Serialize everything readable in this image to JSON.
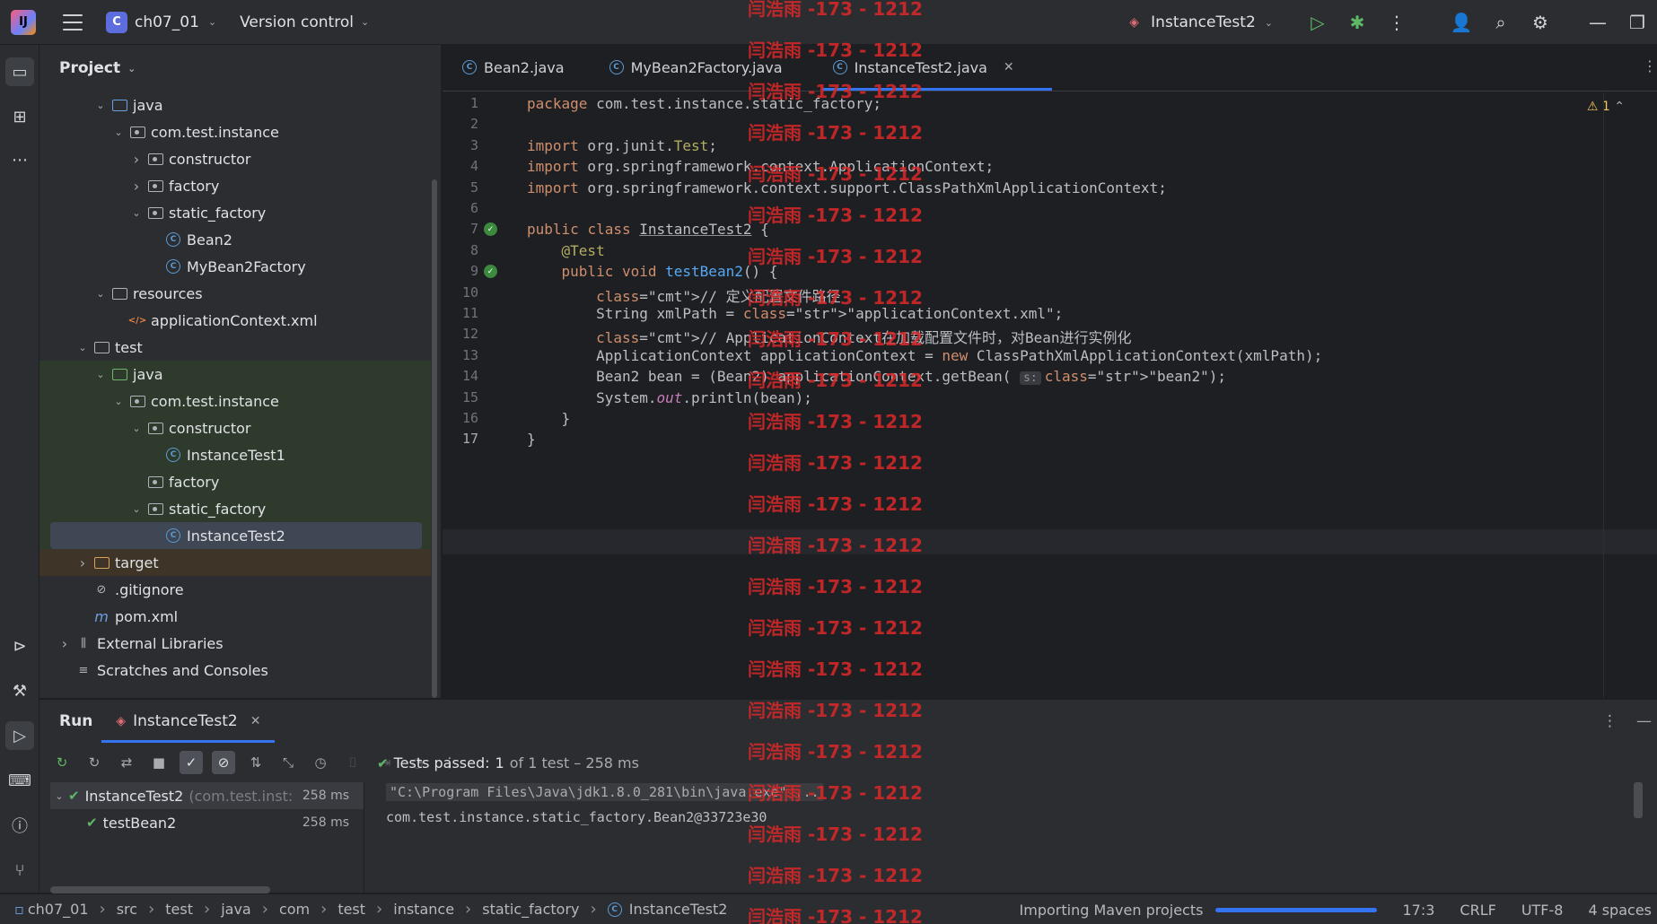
{
  "titlebar": {
    "logo": "IJ",
    "project_badge": "C",
    "project_name": "ch07_01",
    "version_control": "Version control",
    "run_config": "InstanceTest2"
  },
  "project_panel": {
    "title": "Project",
    "items": [
      {
        "label": "java",
        "indent": 3,
        "arrow": "v",
        "icon": "folder-blue"
      },
      {
        "label": "com.test.instance",
        "indent": 4,
        "arrow": "v",
        "icon": "package"
      },
      {
        "label": "constructor",
        "indent": 5,
        "arrow": ">",
        "icon": "package"
      },
      {
        "label": "factory",
        "indent": 5,
        "arrow": ">",
        "icon": "package"
      },
      {
        "label": "static_factory",
        "indent": 5,
        "arrow": "v",
        "icon": "package"
      },
      {
        "label": "Bean2",
        "indent": 6,
        "arrow": "",
        "icon": "class"
      },
      {
        "label": "MyBean2Factory",
        "indent": 6,
        "arrow": "",
        "icon": "class"
      },
      {
        "label": "resources",
        "indent": 3,
        "arrow": "v",
        "icon": "folder"
      },
      {
        "label": "applicationContext.xml",
        "indent": 4,
        "arrow": "",
        "icon": "xml"
      },
      {
        "label": "test",
        "indent": 2,
        "arrow": "v",
        "icon": "folder"
      },
      {
        "label": "java",
        "indent": 3,
        "arrow": "v",
        "icon": "folder-green"
      },
      {
        "label": "com.test.instance",
        "indent": 4,
        "arrow": "v",
        "icon": "package"
      },
      {
        "label": "constructor",
        "indent": 5,
        "arrow": "v",
        "icon": "package"
      },
      {
        "label": "InstanceTest1",
        "indent": 6,
        "arrow": "",
        "icon": "class"
      },
      {
        "label": "factory",
        "indent": 5,
        "arrow": "",
        "icon": "package"
      },
      {
        "label": "static_factory",
        "indent": 5,
        "arrow": "v",
        "icon": "package"
      },
      {
        "label": "InstanceTest2",
        "indent": 6,
        "arrow": "",
        "icon": "class"
      },
      {
        "label": "target",
        "indent": 2,
        "arrow": ">",
        "icon": "folder-orange"
      },
      {
        "label": ".gitignore",
        "indent": 2,
        "arrow": "",
        "icon": "ignore"
      },
      {
        "label": "pom.xml",
        "indent": 2,
        "arrow": "",
        "icon": "maven"
      },
      {
        "label": "External Libraries",
        "indent": 1,
        "arrow": ">",
        "icon": "library"
      },
      {
        "label": "Scratches and Consoles",
        "indent": 1,
        "arrow": "",
        "icon": "scratch"
      }
    ]
  },
  "editor": {
    "tabs": [
      {
        "label": "Bean2.java",
        "active": false
      },
      {
        "label": "MyBean2Factory.java",
        "active": false
      },
      {
        "label": "InstanceTest2.java",
        "active": true
      }
    ],
    "warning_count": "1",
    "lines": [
      "package com.test.instance.static_factory;",
      "",
      "import org.junit.Test;",
      "import org.springframework.context.ApplicationContext;",
      "import org.springframework.context.support.ClassPathXmlApplicationContext;",
      "",
      "public class InstanceTest2 {",
      "    @Test",
      "    public void testBean2() {",
      "        // 定义配置文件路径",
      "        String xmlPath = \"applicationContext.xml\";",
      "        // ApplicationContext在加载配置文件时，对Bean进行实例化",
      "        ApplicationContext applicationContext = new ClassPathXmlApplicationContext(xmlPath);",
      "        Bean2 bean = (Bean2) applicationContext.getBean( s: \"bean2\");",
      "        System.out.println(bean);",
      "    }",
      "}"
    ]
  },
  "run_panel": {
    "title": "Run",
    "tab_label": "InstanceTest2",
    "tests": [
      {
        "name": "InstanceTest2",
        "detail": "(com.test.inst:",
        "duration": "258 ms"
      },
      {
        "name": "testBean2",
        "detail": "",
        "duration": "258 ms"
      }
    ],
    "summary_prefix": "Tests passed:",
    "summary_count": "1",
    "summary_suffix": "of 1 test – 258 ms",
    "console_lines": [
      "\"C:\\Program Files\\Java\\jdk1.8.0_281\\bin\\java.exe\" ...",
      "com.test.instance.static_factory.Bean2@33723e30"
    ]
  },
  "statusbar": {
    "breadcrumb": [
      "ch07_01",
      "src",
      "test",
      "java",
      "com",
      "test",
      "instance",
      "static_factory",
      "InstanceTest2"
    ],
    "task": "Importing Maven projects",
    "position": "17:3",
    "line_sep": "CRLF",
    "encoding": "UTF-8",
    "indent": "4 spaces"
  },
  "watermark": "闫浩雨 -173 - 1212"
}
